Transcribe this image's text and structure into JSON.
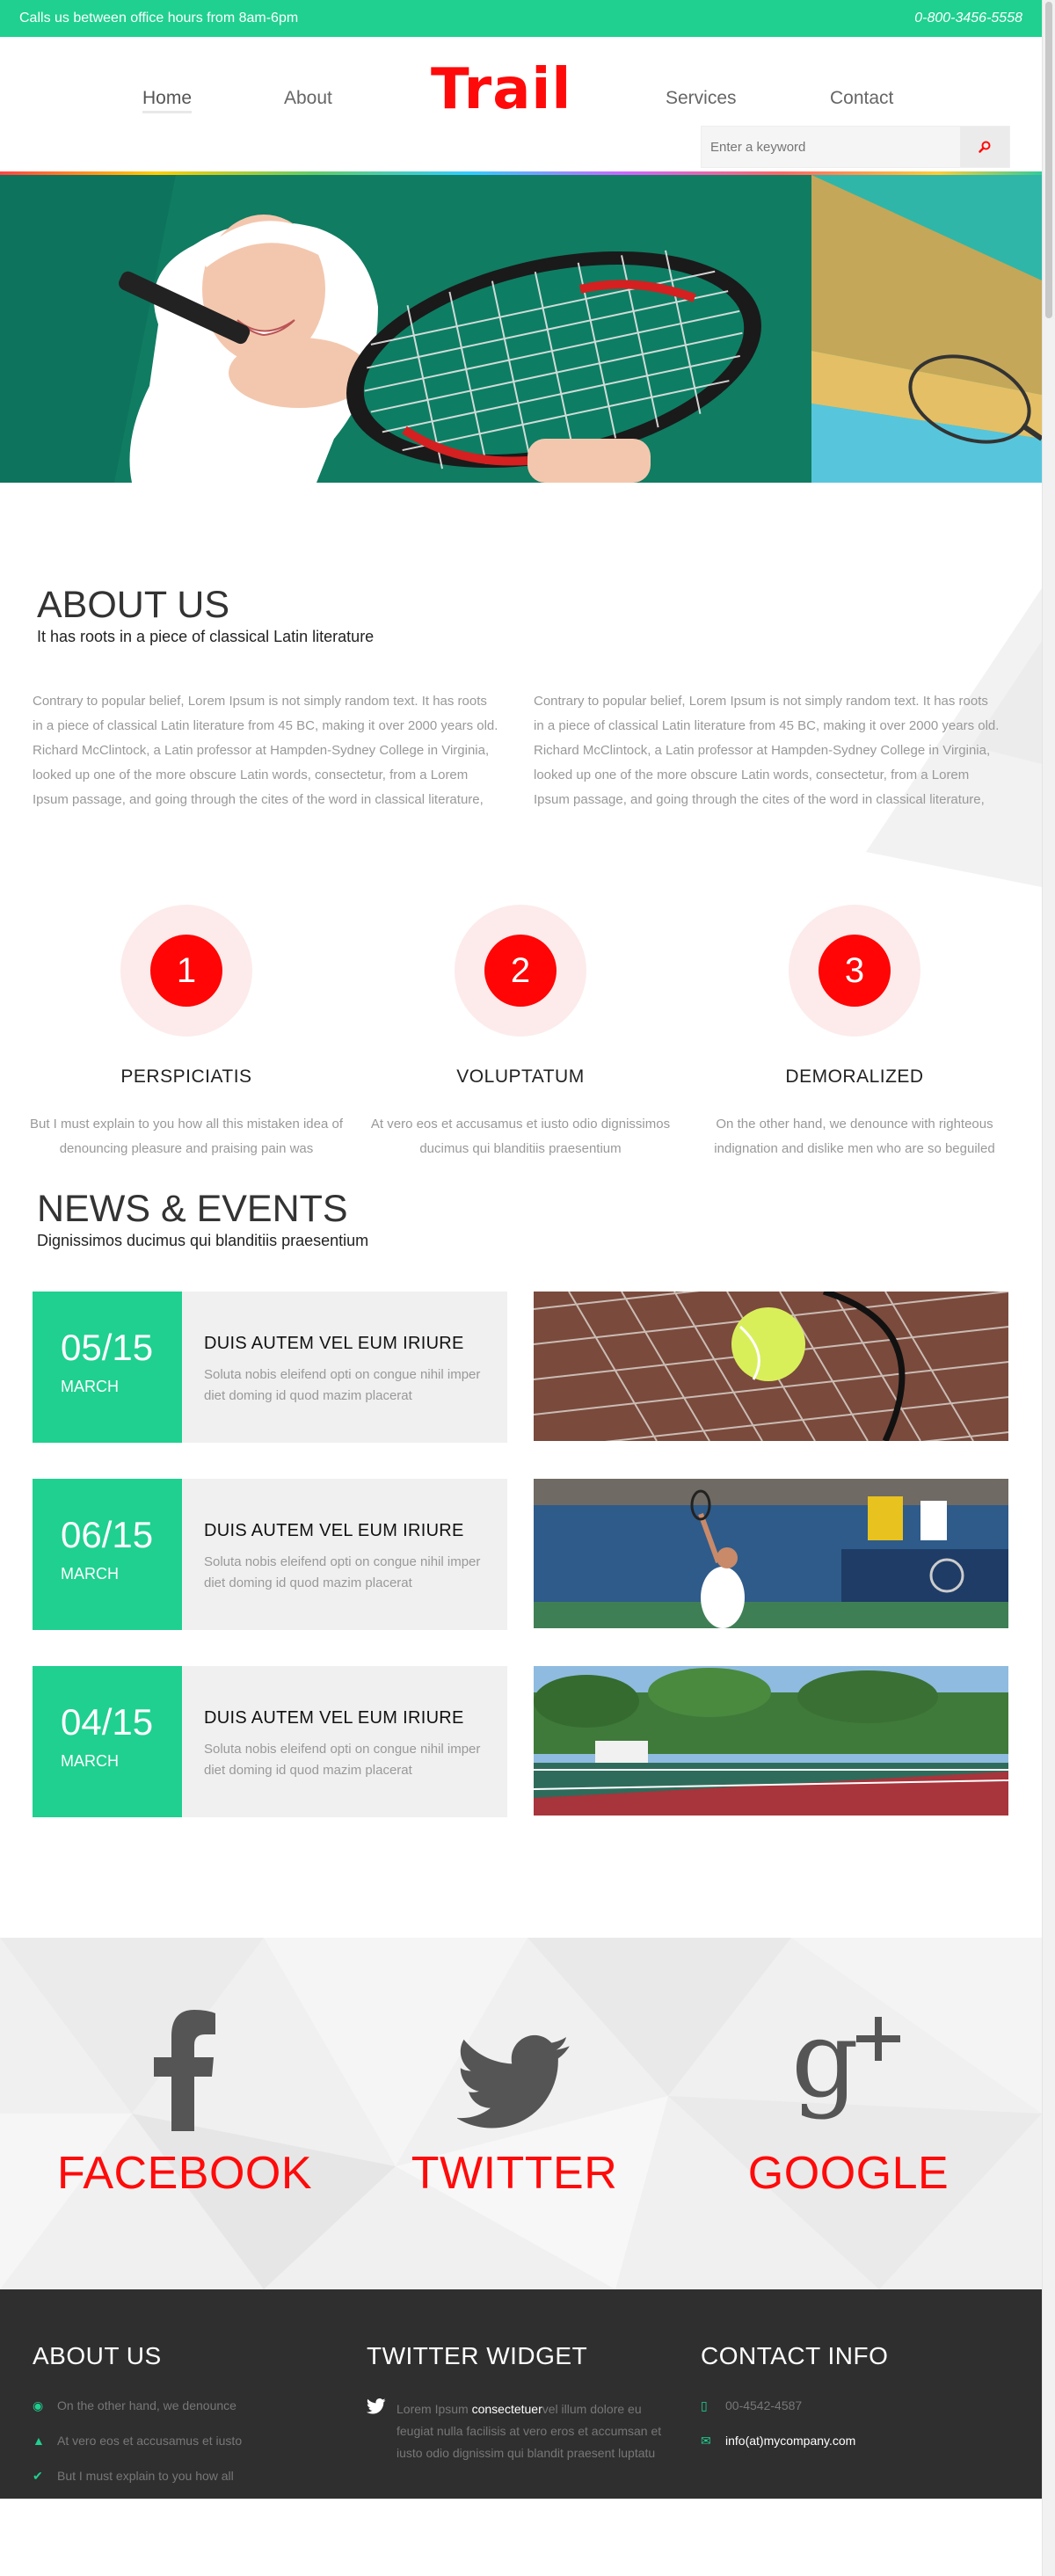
{
  "topbar": {
    "hours": "Calls us between office hours from 8am-6pm",
    "phone": "0-800-3456-5558"
  },
  "nav": {
    "items": [
      "Home",
      "About",
      "Services",
      "Contact"
    ],
    "logo": "Trail"
  },
  "search": {
    "placeholder": "Enter a keyword"
  },
  "about": {
    "title": "ABOUT US",
    "subtitle": "It has roots in a piece of classical Latin literature",
    "paragraphs": [
      "Contrary to popular belief, Lorem Ipsum is not simply random text. It has roots in a piece of classical Latin literature from 45 BC, making it over 2000 years old. Richard McClintock, a Latin professor at Hampden-Sydney College in Virginia, looked up one of the more obscure Latin words, consectetur, from a Lorem Ipsum passage, and going through the cites of the word in classical literature,",
      "Contrary to popular belief, Lorem Ipsum is not simply random text. It has roots in a piece of classical Latin literature from 45 BC, making it over 2000 years old. Richard McClintock, a Latin professor at Hampden-Sydney College in Virginia, looked up one of the more obscure Latin words, consectetur, from a Lorem Ipsum passage, and going through the cites of the word in classical literature,"
    ],
    "features": [
      {
        "num": "1",
        "title": "PERSPICIATIS",
        "text": "But I must explain to you how all this mistaken idea of denouncing pleasure and praising pain was"
      },
      {
        "num": "2",
        "title": "VOLUPTATUM",
        "text": "At vero eos et accusamus et iusto odio dignissimos ducimus qui blanditiis praesentium"
      },
      {
        "num": "3",
        "title": "DEMORALIZED",
        "text": "On the other hand, we denounce with righteous indignation and dislike men who are so beguiled"
      }
    ]
  },
  "news": {
    "title": "NEWS & EVENTS",
    "subtitle": "Dignissimos ducimus qui blanditiis praesentium",
    "items": [
      {
        "day": "05/15",
        "month": "MARCH",
        "heading": "DUIS AUTEM VEL EUM IRIURE",
        "text": "Soluta nobis eleifend opti on congue nihil imper diet doming id quod mazim placerat"
      },
      {
        "day": "06/15",
        "month": "MARCH",
        "heading": "DUIS AUTEM VEL EUM IRIURE",
        "text": "Soluta nobis eleifend opti on congue nihil imper diet doming id quod mazim placerat"
      },
      {
        "day": "04/15",
        "month": "MARCH",
        "heading": "DUIS AUTEM VEL EUM IRIURE",
        "text": "Soluta nobis eleifend opti on congue nihil imper diet doming id quod mazim placerat"
      }
    ]
  },
  "social": {
    "items": [
      {
        "label": "FACEBOOK",
        "icon": "facebook-icon"
      },
      {
        "label": "TWITTER",
        "icon": "twitter-icon"
      },
      {
        "label": "GOOGLE",
        "icon": "google-plus-icon"
      }
    ]
  },
  "footer": {
    "about": {
      "title": "ABOUT US",
      "items": [
        {
          "icon": "gamepad-icon",
          "text": "On the other hand, we denounce"
        },
        {
          "icon": "trophy-icon",
          "text": "At vero eos et accusamus et iusto"
        },
        {
          "icon": "check-circle-icon",
          "text": "But I must explain to you how all"
        }
      ]
    },
    "twitter": {
      "title": "TWITTER WIDGET",
      "text_before": "Lorem Ipsum ",
      "highlight": "consectetuer",
      "text_after": "vel illum dolore eu feugiat nulla facilisis at vero eros et accumsan et iusto odio dignissim qui blandit praesent luptatu"
    },
    "contact": {
      "title": "CONTACT INFO",
      "phone": "00-4542-4587",
      "email": "info(at)mycompany.com"
    }
  },
  "colors": {
    "accent": "#1fd090",
    "brand_red": "#ff0a0a",
    "footer_bg": "#2f2f2f"
  }
}
